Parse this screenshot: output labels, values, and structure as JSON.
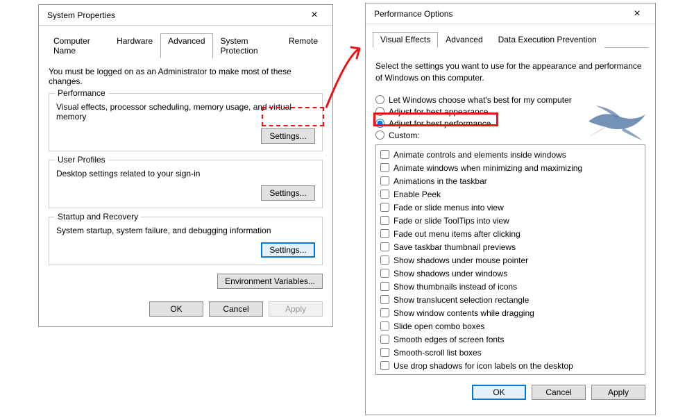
{
  "left": {
    "title": "System Properties",
    "tabs": [
      "Computer Name",
      "Hardware",
      "Advanced",
      "System Protection",
      "Remote"
    ],
    "active_tab": 2,
    "intro": "You must be logged on as an Administrator to make most of these changes.",
    "groups": [
      {
        "legend": "Performance",
        "desc": "Visual effects, processor scheduling, memory usage, and virtual memory",
        "button": "Settings..."
      },
      {
        "legend": "User Profiles",
        "desc": "Desktop settings related to your sign-in",
        "button": "Settings..."
      },
      {
        "legend": "Startup and Recovery",
        "desc": "System startup, system failure, and debugging information",
        "button": "Settings..."
      }
    ],
    "env_button": "Environment Variables...",
    "ok": "OK",
    "cancel": "Cancel",
    "apply": "Apply"
  },
  "right": {
    "title": "Performance Options",
    "tabs": [
      "Visual Effects",
      "Advanced",
      "Data Execution Prevention"
    ],
    "active_tab": 0,
    "desc": "Select the settings you want to use for the appearance and performance of Windows on this computer.",
    "radios": [
      "Let Windows choose what's best for my computer",
      "Adjust for best appearance",
      "Adjust for best performance",
      "Custom:"
    ],
    "selected_radio": 2,
    "checks": [
      "Animate controls and elements inside windows",
      "Animate windows when minimizing and maximizing",
      "Animations in the taskbar",
      "Enable Peek",
      "Fade or slide menus into view",
      "Fade or slide ToolTips into view",
      "Fade out menu items after clicking",
      "Save taskbar thumbnail previews",
      "Show shadows under mouse pointer",
      "Show shadows under windows",
      "Show thumbnails instead of icons",
      "Show translucent selection rectangle",
      "Show window contents while dragging",
      "Slide open combo boxes",
      "Smooth edges of screen fonts",
      "Smooth-scroll list boxes",
      "Use drop shadows for icon labels on the desktop"
    ],
    "ok": "OK",
    "cancel": "Cancel",
    "apply": "Apply"
  }
}
